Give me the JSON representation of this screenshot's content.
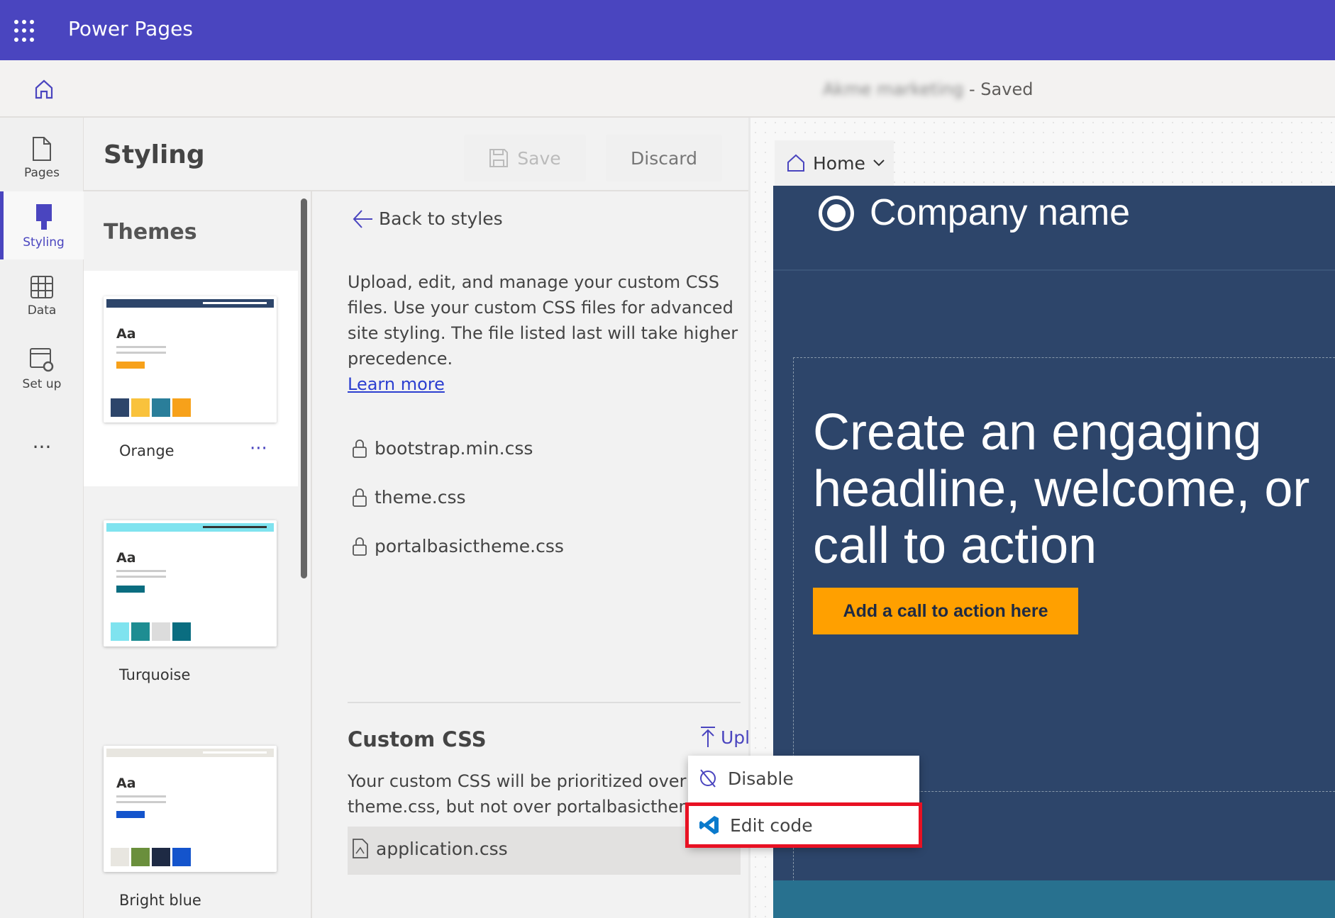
{
  "app": {
    "title": "Power Pages"
  },
  "header": {
    "site_name": "Akme marketing",
    "status": "- Saved"
  },
  "rail": [
    {
      "label": "Pages",
      "icon": "page-icon"
    },
    {
      "label": "Styling",
      "icon": "paintbrush-icon",
      "active": true
    },
    {
      "label": "Data",
      "icon": "table-icon"
    },
    {
      "label": "Set up",
      "icon": "settings-icon"
    },
    {
      "label": "...",
      "icon": "more-icon"
    }
  ],
  "panel": {
    "title": "Styling",
    "save": "Save",
    "discard": "Discard"
  },
  "themes": {
    "title": "Themes",
    "items": [
      {
        "name": "Orange",
        "swatches": [
          "#2d456a",
          "#f9c23c",
          "#2a7e9a",
          "#f7a11a"
        ],
        "bar": "#2d456a",
        "accent": "#f7a11a",
        "selected": true
      },
      {
        "name": "Turquoise",
        "swatches": [
          "#7fe3ef",
          "#1e8d92",
          "#dcdcdc",
          "#0a6d80"
        ],
        "bar": "#7fe3ef",
        "accent": "#0a6d80"
      },
      {
        "name": "Bright blue",
        "swatches": [
          "#e8e6e0",
          "#6a8f3c",
          "#1e2a44",
          "#1454cc"
        ],
        "bar": "#e8e6e0",
        "accent": "#1454cc"
      }
    ]
  },
  "detail": {
    "back": "Back to styles",
    "description": "Upload, edit, and manage your custom CSS files. Use your custom CSS files for advanced site styling. The file listed last will take higher precedence.",
    "learn_more": "Learn more",
    "locked_files": [
      "bootstrap.min.css",
      "theme.css",
      "portalbasictheme.css"
    ],
    "custom_title": "Custom CSS",
    "upload": "Upload",
    "custom_desc": "Your custom CSS will be prioritized over theme.css, but not over portalbasictheme.css.",
    "custom_file": "application.css"
  },
  "menu": {
    "items": [
      "Disable",
      "Edit code"
    ],
    "highlight": "#e81123"
  },
  "preview": {
    "tab": "Home",
    "company": "Company name",
    "headline": "Create an engaging headline, welcome, or call to action",
    "cta": "Add a call to action here",
    "cta_color": "#ffa000"
  }
}
